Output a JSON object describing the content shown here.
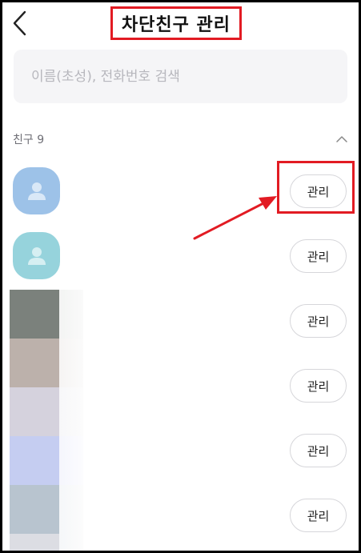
{
  "header": {
    "title": "차단친구 관리",
    "back_icon": "chevron-left-icon"
  },
  "search": {
    "placeholder": "이름(초성), 전화번호 검색",
    "value": ""
  },
  "section": {
    "label": "친구 9",
    "collapse_icon": "chevron-up-icon"
  },
  "friends": [
    {
      "manage_label": "관리",
      "avatar_color": "#9dc2e8"
    },
    {
      "manage_label": "관리",
      "avatar_color": "#96d3dc"
    },
    {
      "manage_label": "관리",
      "avatar_color": "#7b817c"
    },
    {
      "manage_label": "관리",
      "avatar_color": "#bcb1ab"
    },
    {
      "manage_label": "관리",
      "avatar_color": "#d5d2dd"
    },
    {
      "manage_label": "관리",
      "avatar_color": "#c5cdf1"
    },
    {
      "manage_label": "관리",
      "avatar_color": "#b8c4cf"
    }
  ],
  "annotation": {
    "highlight_color": "#e21b23"
  }
}
